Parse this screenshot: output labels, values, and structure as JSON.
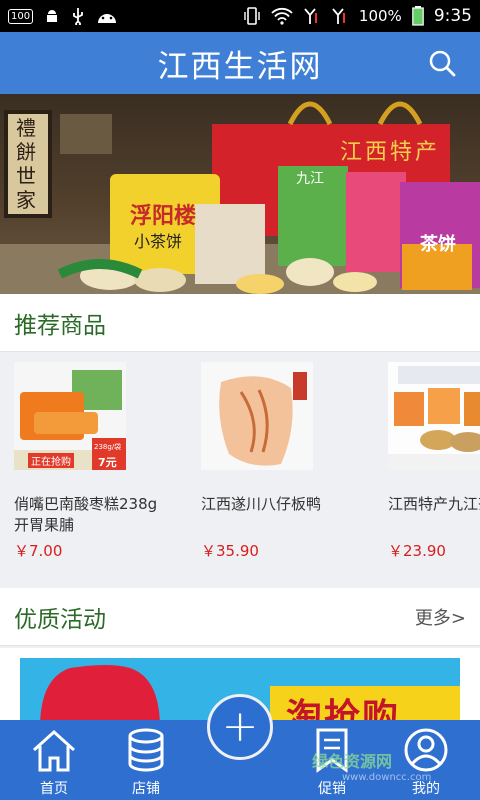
{
  "status_bar": {
    "badge": "100",
    "battery": "100%",
    "time": "9:35"
  },
  "header": {
    "title": "江西生活网"
  },
  "banner": {
    "sign": "禮餅世家",
    "box_text": "江西特产",
    "bag_brand": "浮阳楼",
    "bag_sub": "小茶饼",
    "tag_text": "九江",
    "pack_text": "茶饼"
  },
  "recommended": {
    "title": "推荐商品",
    "products": [
      {
        "name": "俏嘴巴南酸枣糕238g 开胃果脯",
        "price": "￥7.00",
        "promo": "正在抢购",
        "promo_price": "7元",
        "weight": "238g/袋"
      },
      {
        "name": "江西遂川八仔板鸭",
        "price": "￥35.90"
      },
      {
        "name": "江西特产九江茶饼",
        "price": "￥23.90"
      }
    ]
  },
  "activity": {
    "title": "优质活动",
    "more": "更多>",
    "banner_text": "淘抢购"
  },
  "bottom_nav": {
    "items": [
      {
        "label": "首页"
      },
      {
        "label": "店铺"
      },
      {
        "label": "促销"
      },
      {
        "label": "我的"
      }
    ]
  },
  "watermark": {
    "main": "绿色资源网",
    "sub": "www.downcc.com"
  },
  "colors": {
    "header": "#3f7fd6",
    "nav": "#2f6fd0",
    "section_title": "#2b6a27",
    "price": "#d61e1e"
  }
}
